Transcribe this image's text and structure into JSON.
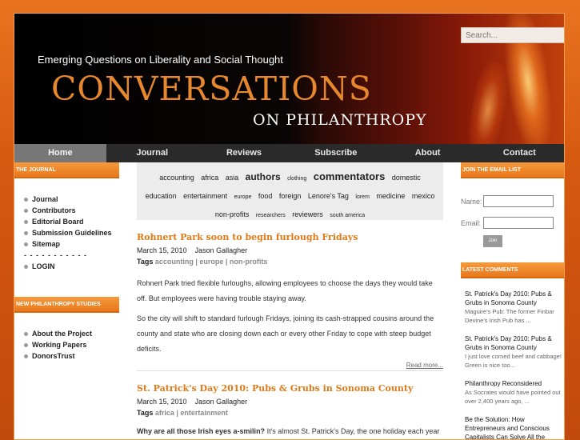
{
  "header": {
    "tagline": "Emerging Questions on Liberality and Social Thought",
    "title": "CONVERSATIONS",
    "subtitle": "ON PHILANTHROPY",
    "search_placeholder": "Search..."
  },
  "nav": [
    "Home",
    "Journal",
    "Reviews",
    "Subscribe",
    "About",
    "Contact"
  ],
  "left": {
    "journal_header": "THE JOURNAL",
    "journal_items": [
      "Journal",
      "Contributors",
      "Editorial Board",
      "Submission Guidelines",
      "Sitemap"
    ],
    "separator": "- - - - - - - - - - -",
    "login": "LOGIN",
    "studies_header": "NEW PHILANTHROPY STUDIES",
    "studies_items": [
      "About the Project",
      "Working Papers",
      "DonorsTrust"
    ]
  },
  "tags": [
    {
      "label": "accounting",
      "size": 9
    },
    {
      "label": "africa",
      "size": 9
    },
    {
      "label": "asia",
      "size": 9
    },
    {
      "label": "authors",
      "size": 12,
      "bold": true
    },
    {
      "label": "clothing",
      "size": 7
    },
    {
      "label": "commentators",
      "size": 13,
      "bold": true
    },
    {
      "label": "domestic",
      "size": 9
    },
    {
      "label": "education",
      "size": 9
    },
    {
      "label": "entertainment",
      "size": 9
    },
    {
      "label": "europe",
      "size": 7
    },
    {
      "label": "food",
      "size": 9
    },
    {
      "label": "foreign",
      "size": 9
    },
    {
      "label": "Lenore's Tag",
      "size": 9
    },
    {
      "label": "lorem",
      "size": 7
    },
    {
      "label": "medicine",
      "size": 9
    },
    {
      "label": "mexico",
      "size": 9
    },
    {
      "label": "non-profits",
      "size": 9
    },
    {
      "label": "researchers",
      "size": 7
    },
    {
      "label": "reviewers",
      "size": 9
    },
    {
      "label": "south america",
      "size": 7
    }
  ],
  "posts": [
    {
      "title": "Rohnert Park soon to begin furlough Fridays",
      "date": "March 15, 2010",
      "author": "Jason Gallagher",
      "tags_label": "Tags",
      "tags": "accounting | europe | non-profits",
      "p1": "Rohnert Park tried flexible furloughs, allowing employees to choose the days they would take off. But employees were having trouble staying away.",
      "p2": "So the city will shift to standard furlough Fridays, joining its cash-strapped cousins around the county and state who are closing down each or every other Friday to cope with steep budget deficits.",
      "read_more": "Read more..."
    },
    {
      "title": "St. Patrick's Day 2010: Pubs & Grubs in Sonoma County",
      "date": "March 15, 2010",
      "author": "Jason Gallagher",
      "tags_label": "Tags",
      "tags": "africa | entertainment",
      "p1_bold": "Why are all those Irish eyes a-smilin?",
      "p1": " It's almost St. Patrick's Day, the one holiday each year where drinking, pinching and a wee bit o' hijinks are the order of the day. Taps turn green, beef"
    }
  ],
  "right": {
    "email_header": "JOIN THE EMAIL LIST",
    "name_label": "Name:",
    "email_label": "Email:",
    "join_label": "Join",
    "comments_header": "LATEST COMMENTS",
    "comments": [
      {
        "title": "St. Patrick's Day 2010: Pubs & Grubs in Sonoma County",
        "excerpt": "Maguire's Pub: The former Finbar Devine's Irish Pub has ..."
      },
      {
        "title": "St. Patrick's Day 2010: Pubs & Grubs in Sonoma County",
        "excerpt": "I just love corned beef and cabbage! Green is nice too..."
      },
      {
        "title": "Philanthropy Reconsidered",
        "excerpt": "As Socrates would have pointed out over 2,400 years ago, ..."
      },
      {
        "title": "Be the Solution: How Entrepreneurs and Conscious Capitalists Can Solve All the",
        "excerpt": ""
      }
    ]
  }
}
